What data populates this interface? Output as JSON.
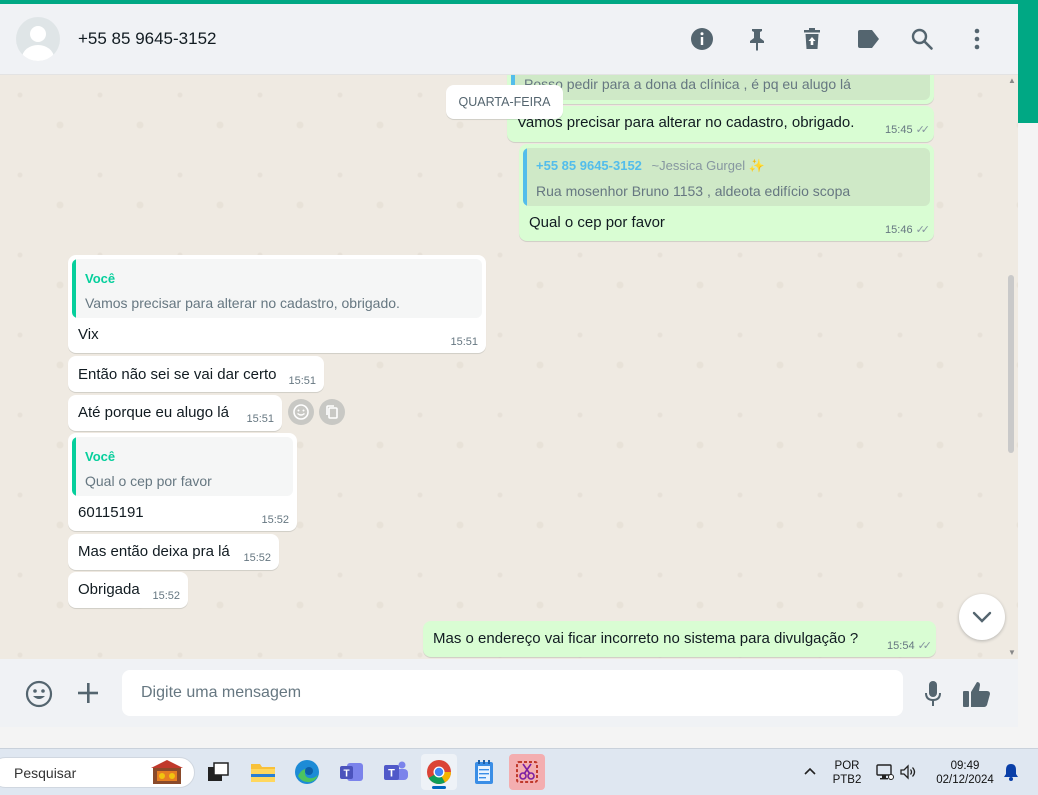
{
  "header": {
    "contact_name": "+55 85 9645-3152",
    "icons": [
      "info-icon",
      "pin-icon",
      "delete-icon",
      "label-icon",
      "search-icon",
      "menu-icon"
    ]
  },
  "date_separator": "QUARTA-FEIRA",
  "messages": {
    "m0": {
      "text": "Posso pedir para a dona da clínica , é pq eu alugo lá"
    },
    "m1": {
      "text": "Vamos precisar para alterar no cadastro, obrigado.",
      "time": "15:45"
    },
    "m2": {
      "quote_author": "+55 85 9645-3152",
      "quote_contact": "~Jessica Gurgel",
      "quote_emoji": "✨",
      "quote_text": "Rua mosenhor Bruno 1153 , aldeota edifício scopa",
      "text": "Qual o cep por favor",
      "time": "15:46"
    },
    "m3": {
      "quote_author": "Você",
      "quote_text": "Vamos precisar para alterar no cadastro, obrigado.",
      "text": "Vix",
      "time": "15:51"
    },
    "m4": {
      "text": "Então não sei se vai dar certo",
      "time": "15:51"
    },
    "m5": {
      "text": "Até porque eu alugo lá",
      "time": "15:51"
    },
    "m6": {
      "quote_author": "Você",
      "quote_text": "Qual o cep por favor",
      "text": "60115191",
      "time": "15:52"
    },
    "m7": {
      "text": "Mas então deixa pra lá",
      "time": "15:52"
    },
    "m8": {
      "text": "Obrigada",
      "time": "15:52"
    },
    "m9": {
      "text": "Mas o endereço vai ficar incorreto no sistema para divulgação ?",
      "time": "15:54"
    }
  },
  "composer": {
    "placeholder": "Digite uma mensagem"
  },
  "taskbar": {
    "search_label": "Pesquisar",
    "lang_line1": "POR",
    "lang_line2": "PTB2",
    "time": "09:49",
    "date": "02/12/2024"
  },
  "colors": {
    "accent": "#00a884",
    "outgoing_bubble": "#d9fdd3",
    "incoming_bubble": "#ffffff",
    "chat_background": "#efeae2",
    "quote_you": "#06cf9c",
    "quote_contact": "#53bdeb"
  }
}
